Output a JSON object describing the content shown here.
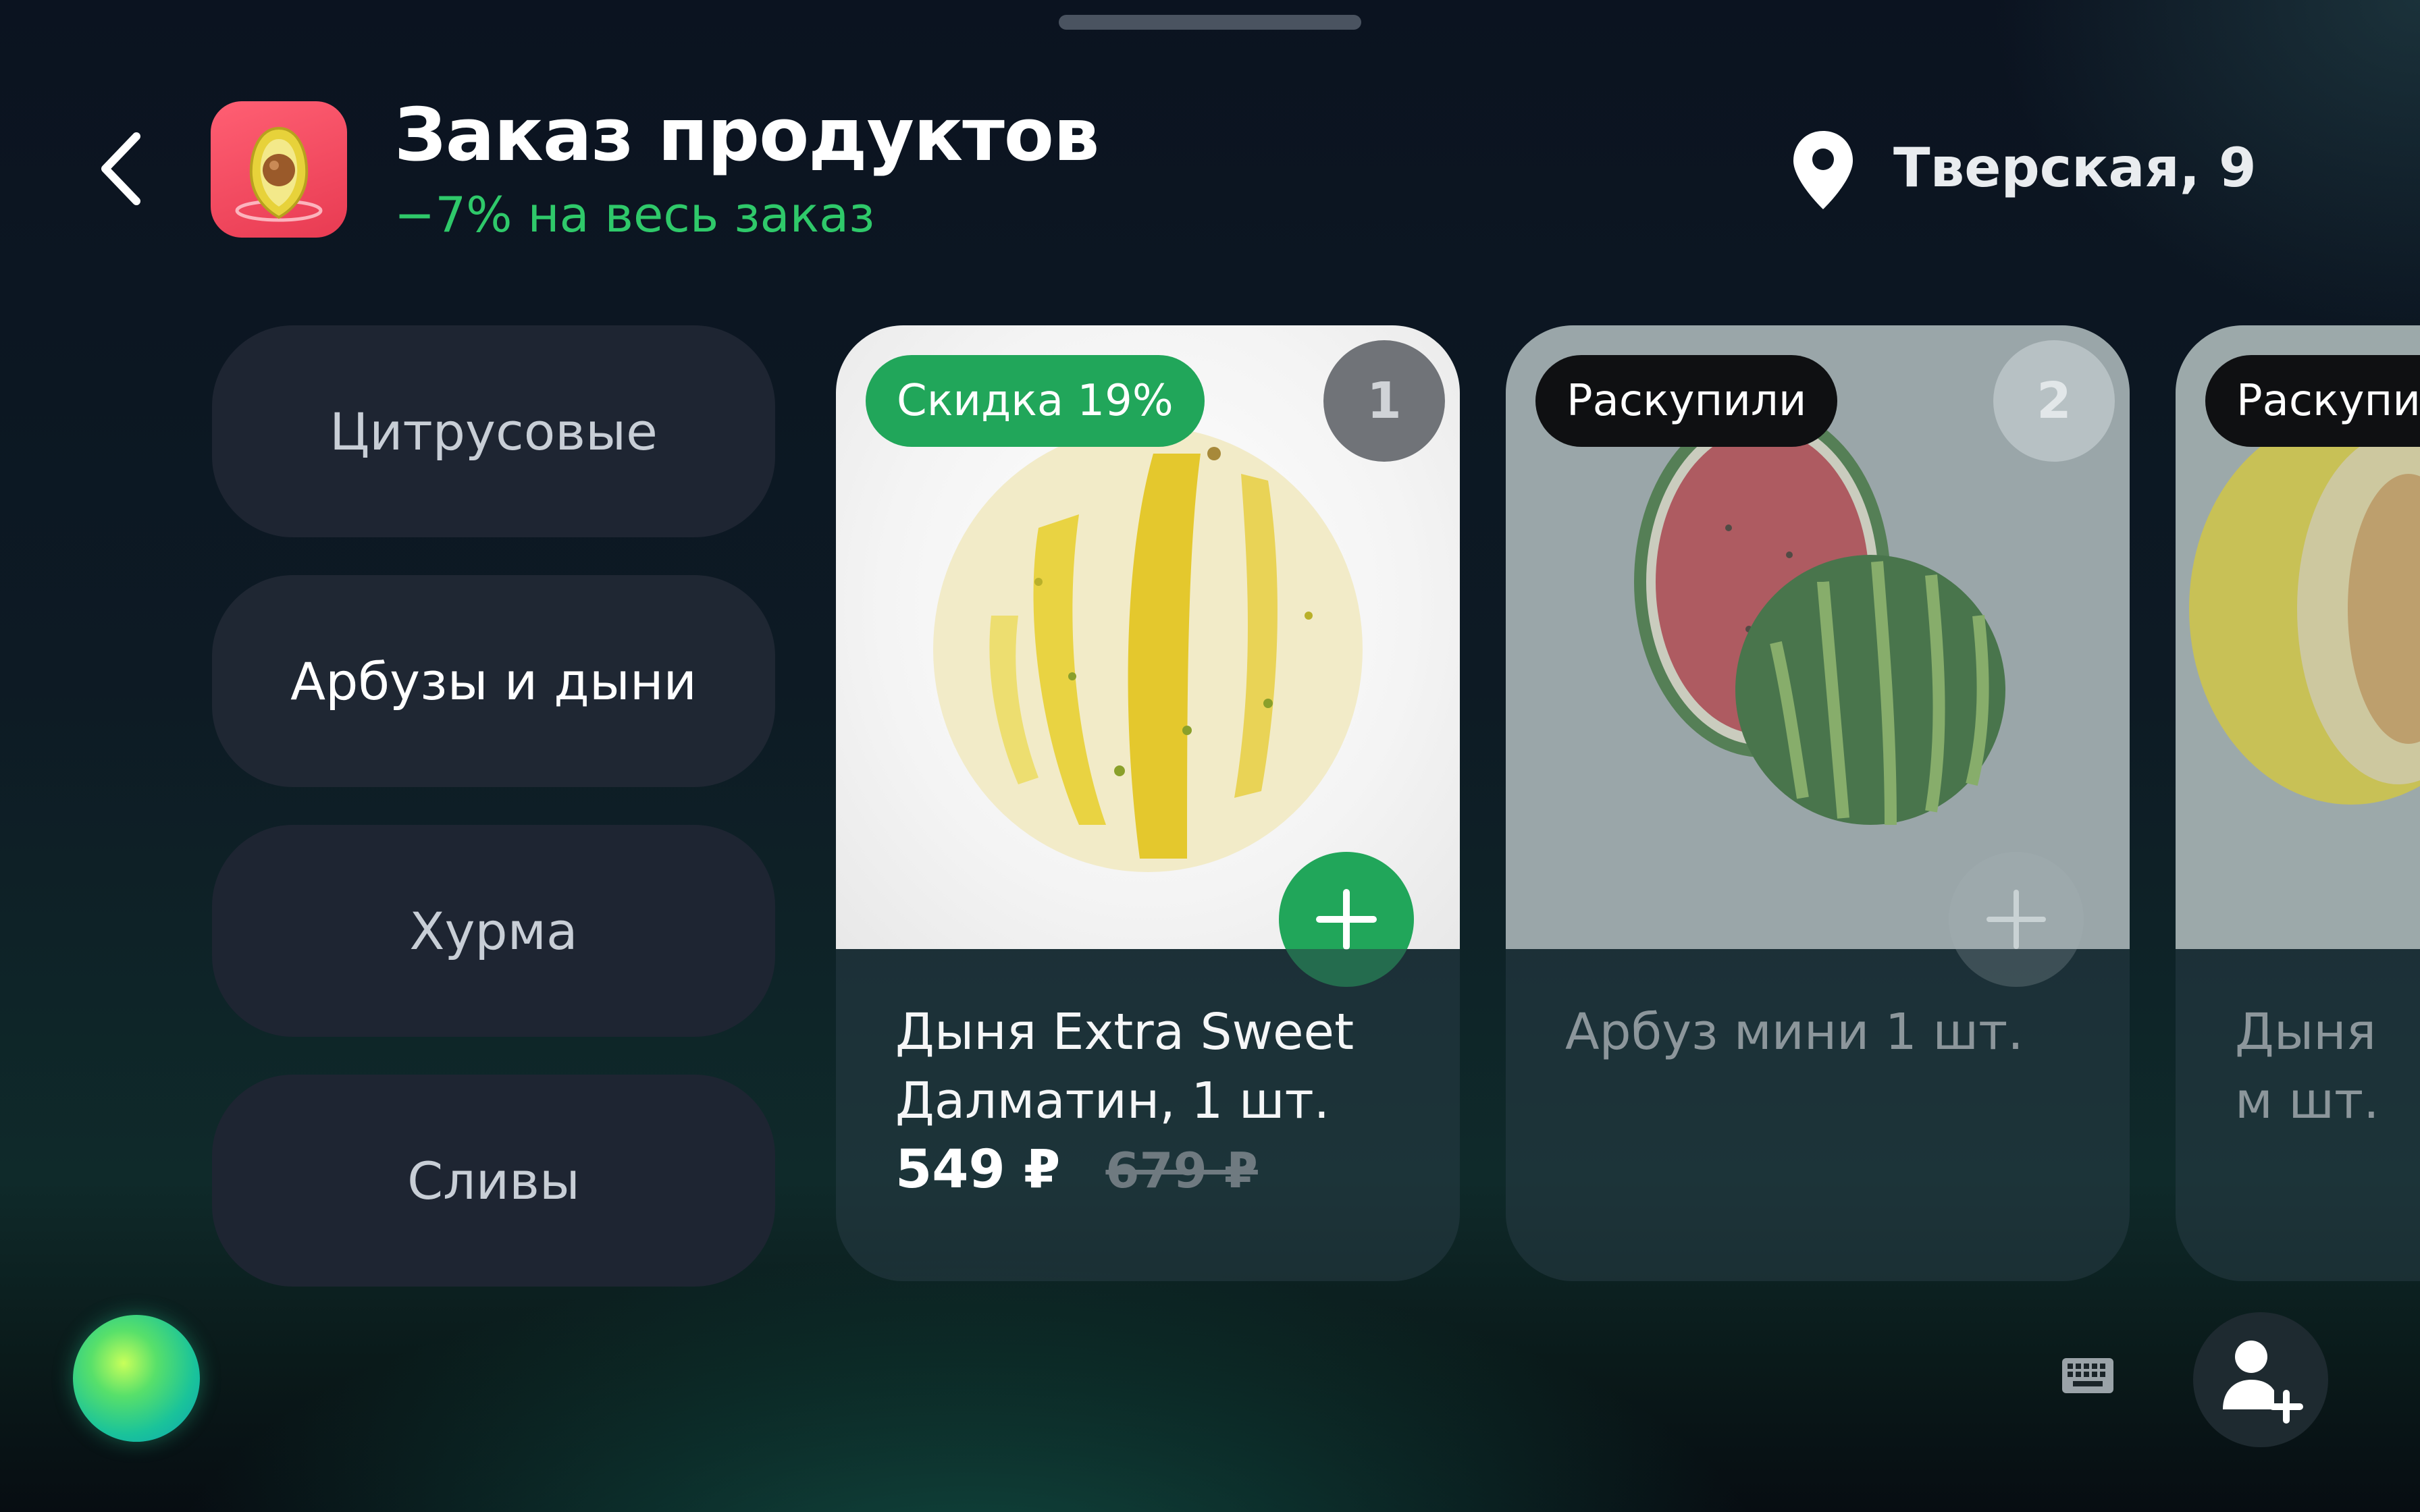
{
  "header": {
    "title": "Заказ продуктов",
    "subtitle": "−7% на весь заказ",
    "location": "Тверская, 9"
  },
  "categories": [
    {
      "label": "Цитрусовые",
      "active": false
    },
    {
      "label": "Арбузы и дыни",
      "active": true
    },
    {
      "label": "Хурма",
      "active": false
    },
    {
      "label": "Сливы",
      "active": false
    }
  ],
  "products": [
    {
      "badge": "Скидка 19%",
      "number": "1",
      "name": "Дыня Extra Sweet Далматин, 1 шт.",
      "price": "549 ₽",
      "old_price": "679 ₽",
      "available": true
    },
    {
      "badge": "Раскупили",
      "number": "2",
      "name": "Арбуз мини 1 шт.",
      "available": false
    },
    {
      "badge": "Раскупили",
      "name": "Дыня м шт.",
      "available": false
    }
  ],
  "colors": {
    "accent_green": "#21a65a",
    "subtitle_green": "#2fc96a",
    "app_icon_red": "#f0455c"
  },
  "icons": [
    "back-chevron-icon",
    "avocado-app-icon",
    "location-pin-icon",
    "plus-icon",
    "assistant-orb-icon",
    "keyboard-icon",
    "add-user-icon"
  ]
}
